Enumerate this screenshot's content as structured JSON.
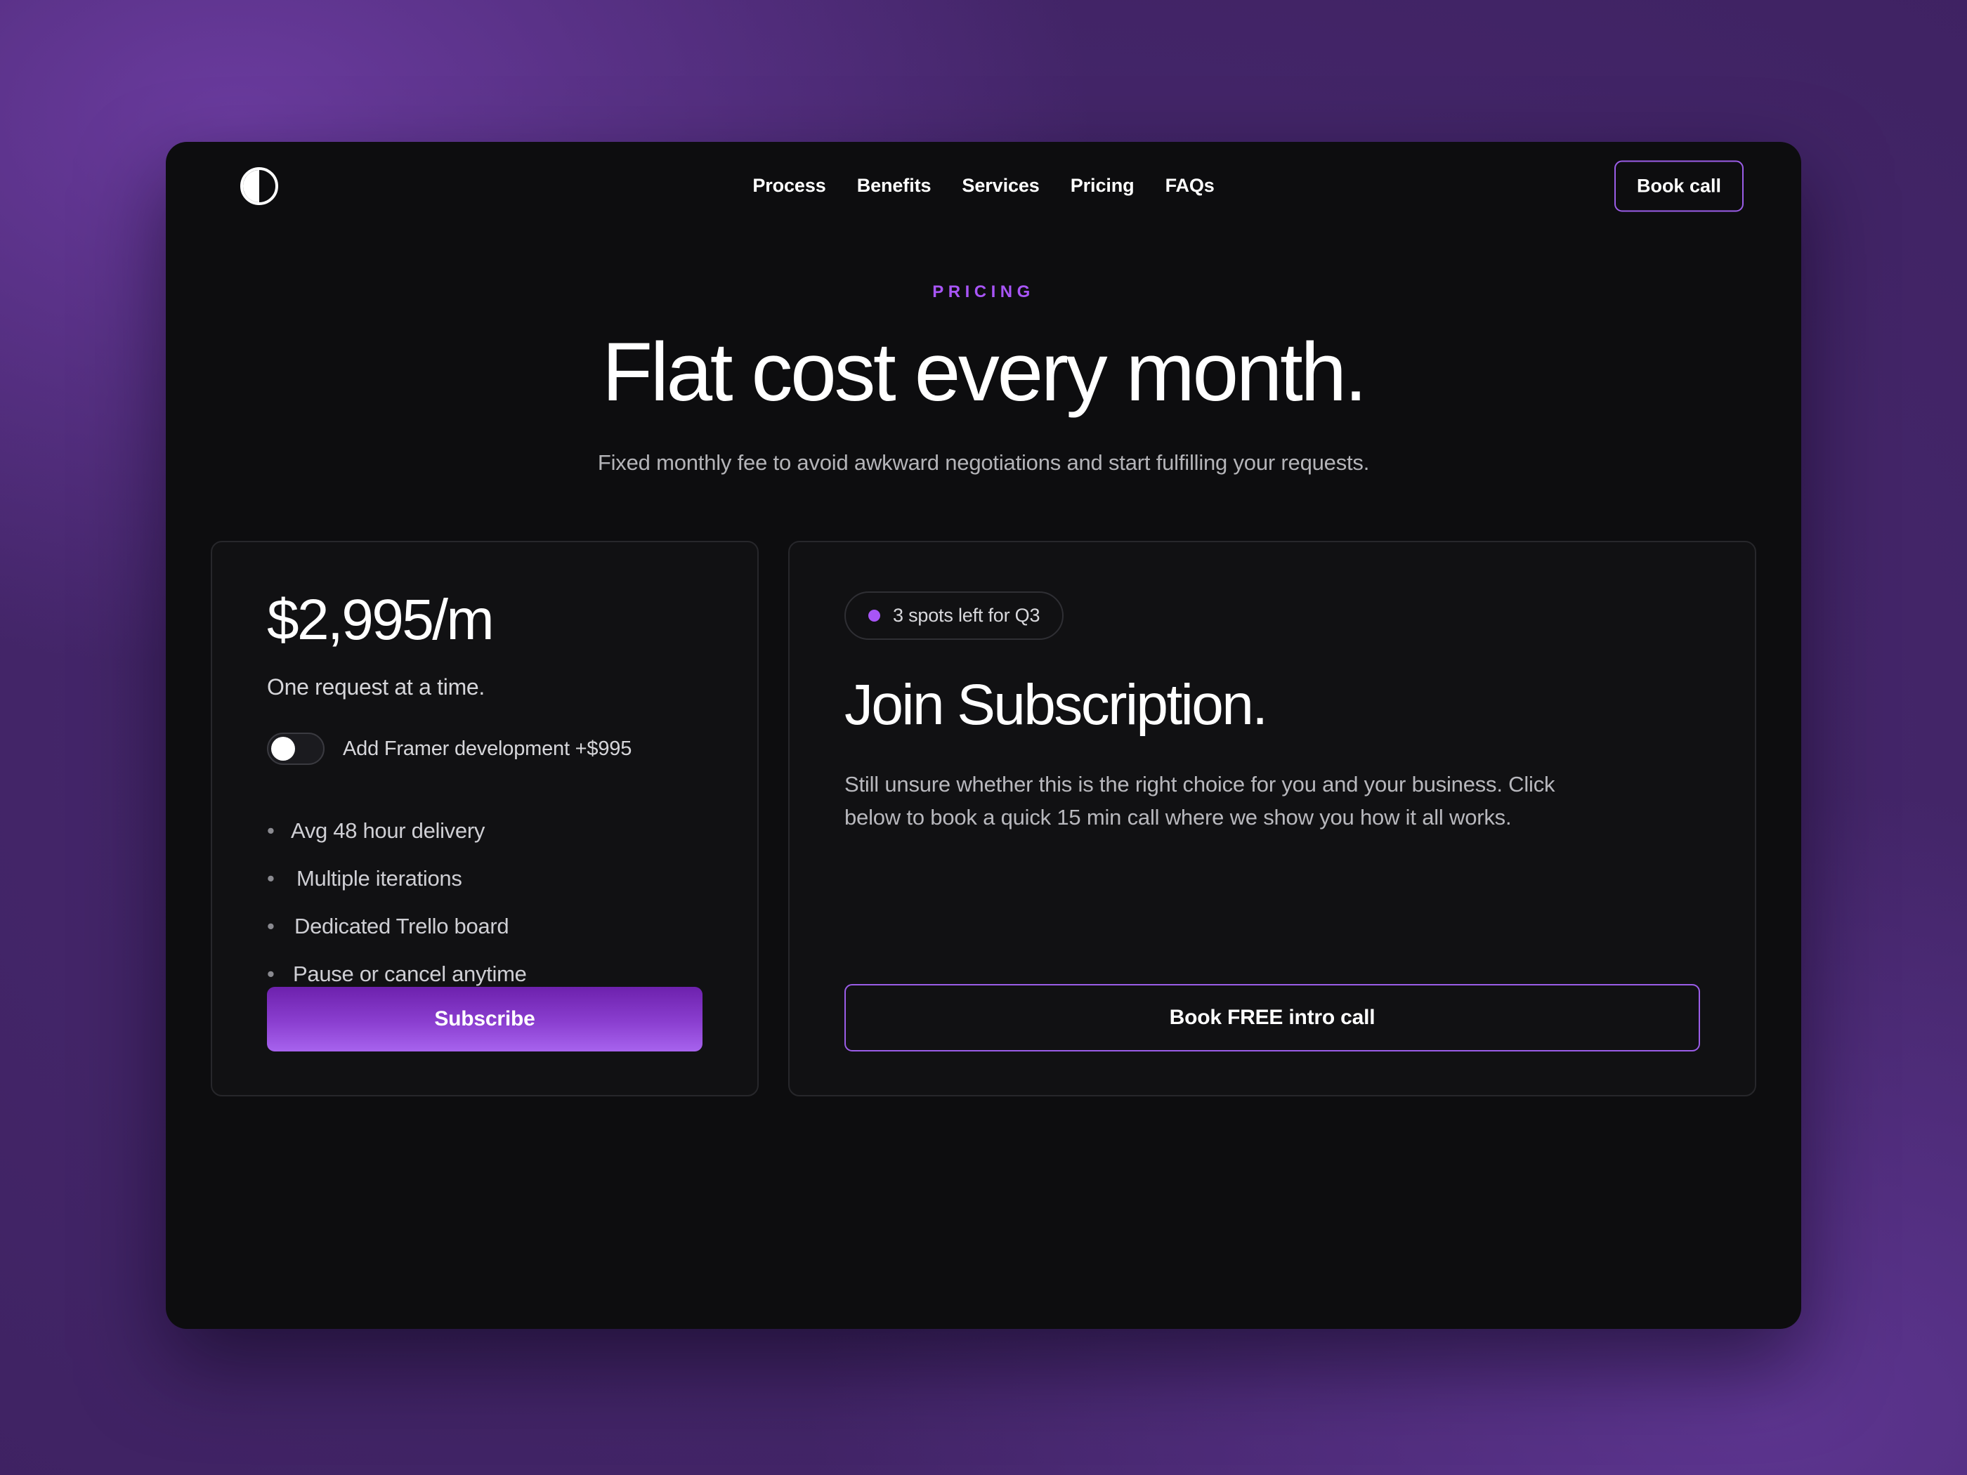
{
  "header": {
    "logo_icon": "half-circle-contrast-icon",
    "nav": [
      {
        "label": "Process"
      },
      {
        "label": "Benefits"
      },
      {
        "label": "Services"
      },
      {
        "label": "Pricing"
      },
      {
        "label": "FAQs"
      }
    ],
    "cta_label": "Book call"
  },
  "hero": {
    "eyebrow": "PRICING",
    "title": "Flat cost every month.",
    "subtitle": "Fixed monthly fee to avoid awkward negotiations and start fulfilling your requests."
  },
  "price_card": {
    "amount": "$2,995/m",
    "tagline": "One request at a time.",
    "addon": {
      "label": "Add Framer development +$995",
      "enabled": false
    },
    "features": [
      {
        "bullet": "•",
        "text": "Avg 48 hour delivery"
      },
      {
        "bullet": "•",
        "text": "Multiple iterations"
      },
      {
        "bullet": "•",
        "text": "Dedicated Trello board"
      },
      {
        "bullet": "•",
        "text": "Pause or cancel anytime"
      }
    ],
    "cta_label": "Subscribe"
  },
  "join_card": {
    "badge": {
      "dot_icon": "purple-dot-icon",
      "text": "3 spots left for Q3"
    },
    "title": "Join Subscription.",
    "body": "Still unsure whether this is the right choice for you and your business. Click below to book a quick 15 min call where we show you how it all works.",
    "cta_label": "Book FREE intro call"
  },
  "colors": {
    "accent_purple": "#a855f7",
    "border_purple": "#9b5de8",
    "card_bg": "#111113",
    "card_border": "#27272b",
    "window_bg": "#0d0d0f",
    "page_gradient_from": "#6a3b9e",
    "page_gradient_to": "#3d2160"
  }
}
